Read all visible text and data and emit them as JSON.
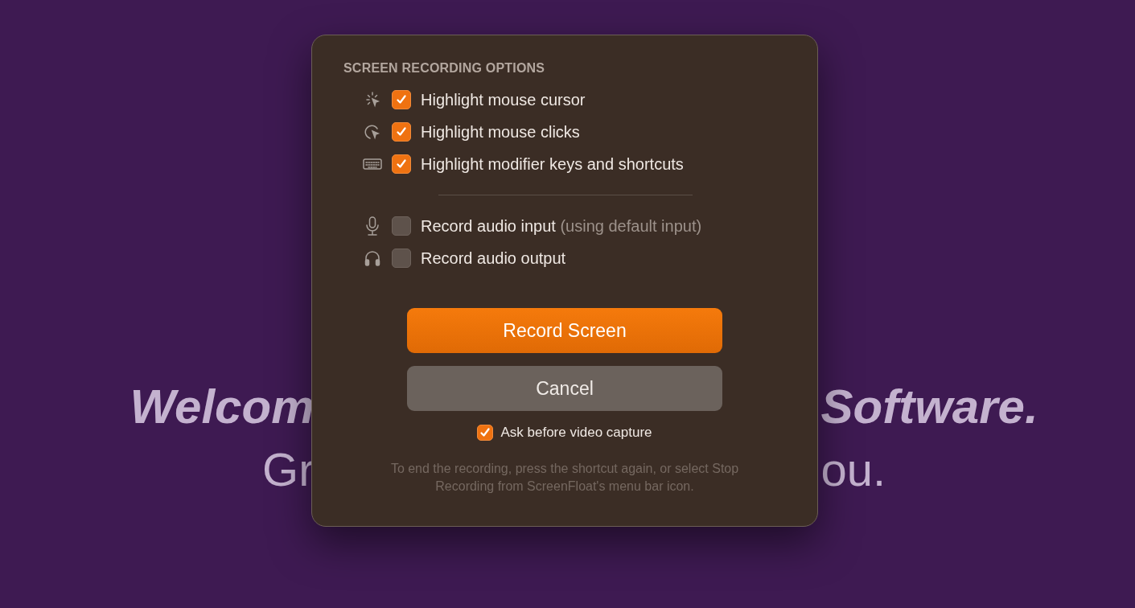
{
  "background": {
    "lines": [
      {
        "left": "Welcom",
        "right": "Software.",
        "kind": "headline"
      },
      {
        "left": "Gr",
        "right": "ou.",
        "kind": "subline"
      }
    ]
  },
  "dialog": {
    "heading": "SCREEN RECORDING OPTIONS",
    "option_groups": [
      [
        {
          "kind": "cursor",
          "label": "Highlight mouse cursor",
          "checked": true
        },
        {
          "kind": "click",
          "label": "Highlight mouse clicks",
          "checked": true
        },
        {
          "kind": "keyboard",
          "label": "Highlight modifier keys and shortcuts",
          "checked": true
        }
      ],
      [
        {
          "kind": "mic",
          "label": "Record audio input",
          "note": "(using default input)",
          "checked": false
        },
        {
          "kind": "headphones",
          "label": "Record audio output",
          "checked": false
        }
      ]
    ],
    "primary_button": "Record Screen",
    "cancel_button": "Cancel",
    "ask_option": {
      "label": "Ask before video capture",
      "checked": true
    },
    "footnote": "To end the recording, press the shortcut again, or select Stop Recording from ScreenFloat's menu bar icon."
  }
}
